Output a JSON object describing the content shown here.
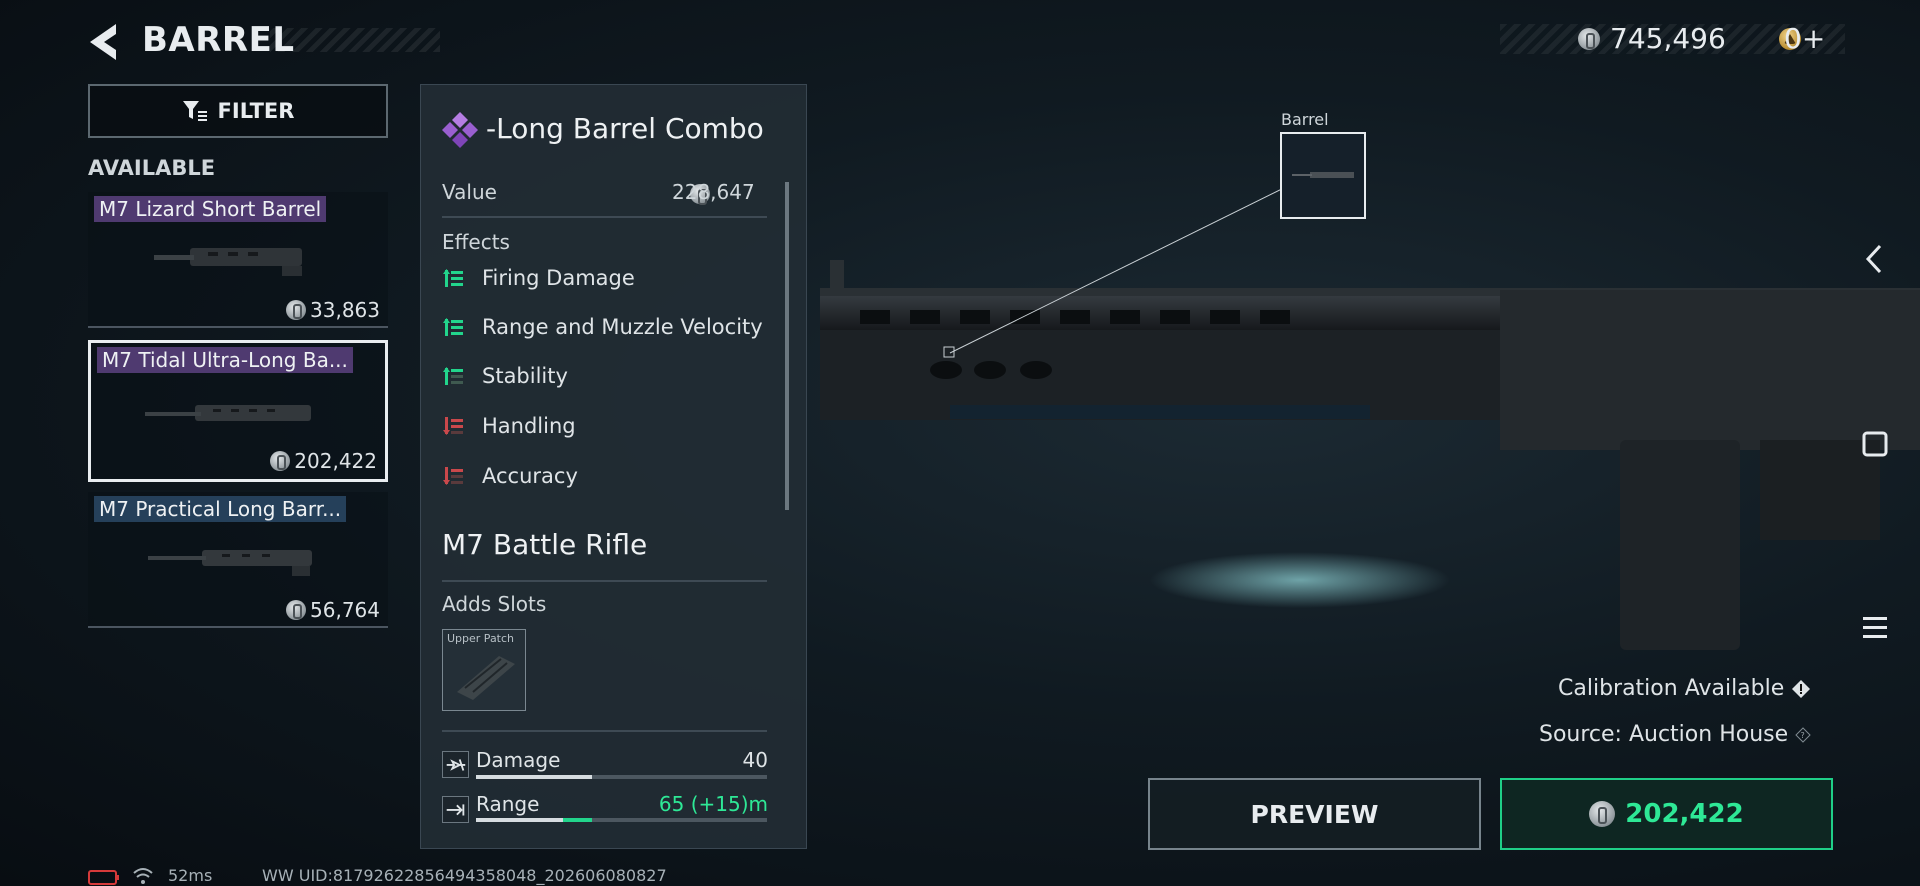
{
  "header": {
    "title": "BARREL",
    "money": "745,496",
    "gold": "0",
    "gold_plus": "+"
  },
  "filter": {
    "label": "FILTER"
  },
  "list": {
    "section_label": "AVAILABLE",
    "items": [
      {
        "name": "M7 Lizard Short Barrel",
        "price": "33,863",
        "rarity_color": "#4f3a70"
      },
      {
        "name": "M7 Tidal Ultra-Long Ba...",
        "price": "202,422",
        "rarity_color": "#4f3a70",
        "selected": true
      },
      {
        "name": "M7 Practical Long Barr...",
        "price": "56,764",
        "rarity_color": "#25405a"
      }
    ]
  },
  "detail": {
    "title": "-Long Barrel Combo",
    "value_label": "Value",
    "value": "228,647",
    "effects_label": "Effects",
    "effects": [
      {
        "label": "Firing Damage",
        "kind": "positive"
      },
      {
        "label": "Range and Muzzle Velocity",
        "kind": "positive"
      },
      {
        "label": "Stability",
        "kind": "positive"
      },
      {
        "label": "Handling",
        "kind": "negative"
      },
      {
        "label": "Accuracy",
        "kind": "negative"
      }
    ],
    "weapon": "M7 Battle Rifle",
    "adds_slots_label": "Adds Slots",
    "slot": "Upper Patch",
    "stats": [
      {
        "label": "Damage",
        "value": "40",
        "level": 0.4,
        "boost": 0
      },
      {
        "label": "Range",
        "value": "65 (+15)m",
        "level": 0.3,
        "boost": 0.1
      }
    ]
  },
  "preview": {
    "callout": "Barrel",
    "calibration": "Calibration Available",
    "source": "Source: Auction House",
    "preview_label": "PREVIEW",
    "price": "202,422"
  },
  "footer": {
    "ping": "52ms",
    "uid": "WW UID:81792622856494358048_202606080827"
  },
  "colors": {
    "accent_green": "#2ee896",
    "rarity_purple": "#4f3a70",
    "rarity_blue": "#25405a",
    "negative_red": "#c9484b"
  }
}
